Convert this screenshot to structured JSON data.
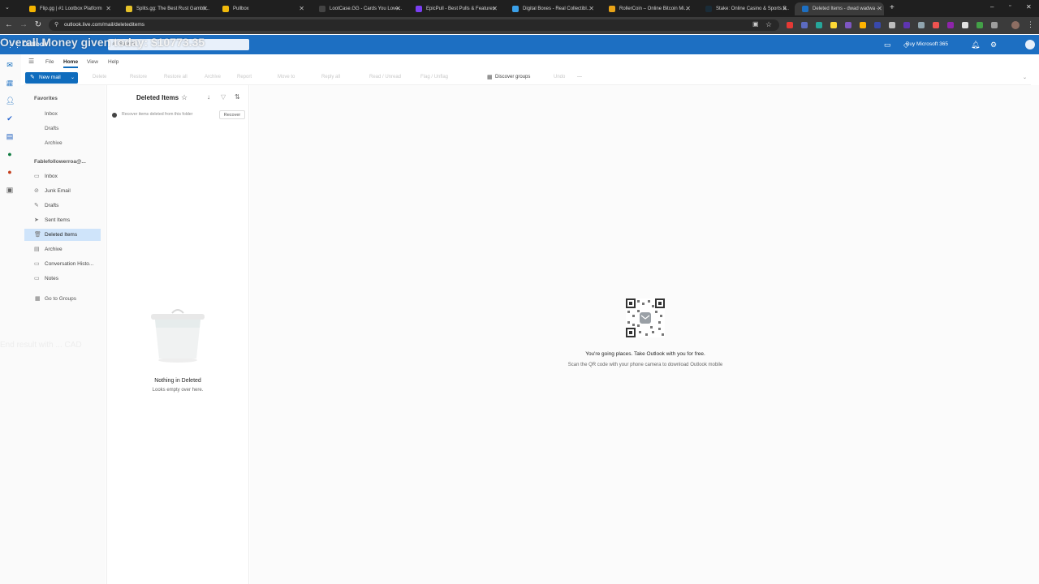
{
  "browser": {
    "tabs": [
      {
        "title": "Flip.gg | #1 Lootbox Platform",
        "color": "#f4b400"
      },
      {
        "title": "Splits.gg: The Best Rust Gambli...",
        "color": "#e6c229"
      },
      {
        "title": "Pullbox",
        "color": "#f0b90b"
      },
      {
        "title": "LootCase.GG - Cards You Love...",
        "color": "#444444"
      },
      {
        "title": "EpicPull - Best Pulls & Features",
        "color": "#7b3ff2"
      },
      {
        "title": "Digital Boxes - Real Collectibl...",
        "color": "#3aa0e8"
      },
      {
        "title": "RollerCoin – Online Bitcoin Mi...",
        "color": "#e8a317"
      },
      {
        "title": "Stake: Online Casino & Sports B...",
        "color": "#1a2c38"
      },
      {
        "title": "Deleted Items - dwad wadwa -",
        "color": "#1d6fc2"
      }
    ],
    "url": "outlook.live.com/mail/deleteditems"
  },
  "header": {
    "search_placeholder": "Search",
    "app_name": "Outlook",
    "buy_label": "Buy Microsoft 365"
  },
  "ribbon": {
    "tabs": [
      "File",
      "Home",
      "View",
      "Help"
    ],
    "new_mail": "New mail",
    "commands": [
      "Delete",
      "Restore",
      "Restore all",
      "Archive",
      "Report",
      "Move to",
      "Reply all",
      "Read / Unread",
      "Flag / Unflag",
      "Discover groups",
      "Undo"
    ]
  },
  "folders": {
    "favorites_header": "Favorites",
    "favorites": [
      "Inbox",
      "Drafts",
      "Archive"
    ],
    "account_header": "Fablefollowerroa@...",
    "items": [
      {
        "label": "Inbox",
        "icon": "inbox-icon",
        "glyph": "▭"
      },
      {
        "label": "Junk Email",
        "icon": "junk-icon",
        "glyph": "⊘"
      },
      {
        "label": "Drafts",
        "icon": "drafts-icon",
        "glyph": "✎"
      },
      {
        "label": "Sent Items",
        "icon": "sent-icon",
        "glyph": "➤"
      },
      {
        "label": "Deleted Items",
        "icon": "trash-icon",
        "glyph": "🗑"
      },
      {
        "label": "Archive",
        "icon": "archive-icon",
        "glyph": "▤"
      },
      {
        "label": "Conversation Histo...",
        "icon": "folder-icon",
        "glyph": "▭"
      },
      {
        "label": "Notes",
        "icon": "notes-icon",
        "glyph": "▭"
      }
    ],
    "groups_link": "Go to Groups"
  },
  "list": {
    "title": "Deleted Items",
    "recover_text": "Recover items deleted from this folder",
    "recover_button": "Recover",
    "empty_title": "Nothing in Deleted",
    "empty_sub": "Looks empty over here."
  },
  "reading": {
    "promo_title": "You're going places. Take Outlook with you for free.",
    "promo_sub": "Scan the QR code with your phone camera to download Outlook mobile"
  },
  "overlay": {
    "money_line": "Overall Money given today: $10773.35",
    "profit_label": "Profit",
    "end_line": "End result with ... CAD"
  },
  "colors": {
    "brand": "#1d6fc2",
    "accent": "#0f6cbd",
    "selected": "#cfe4fa"
  }
}
